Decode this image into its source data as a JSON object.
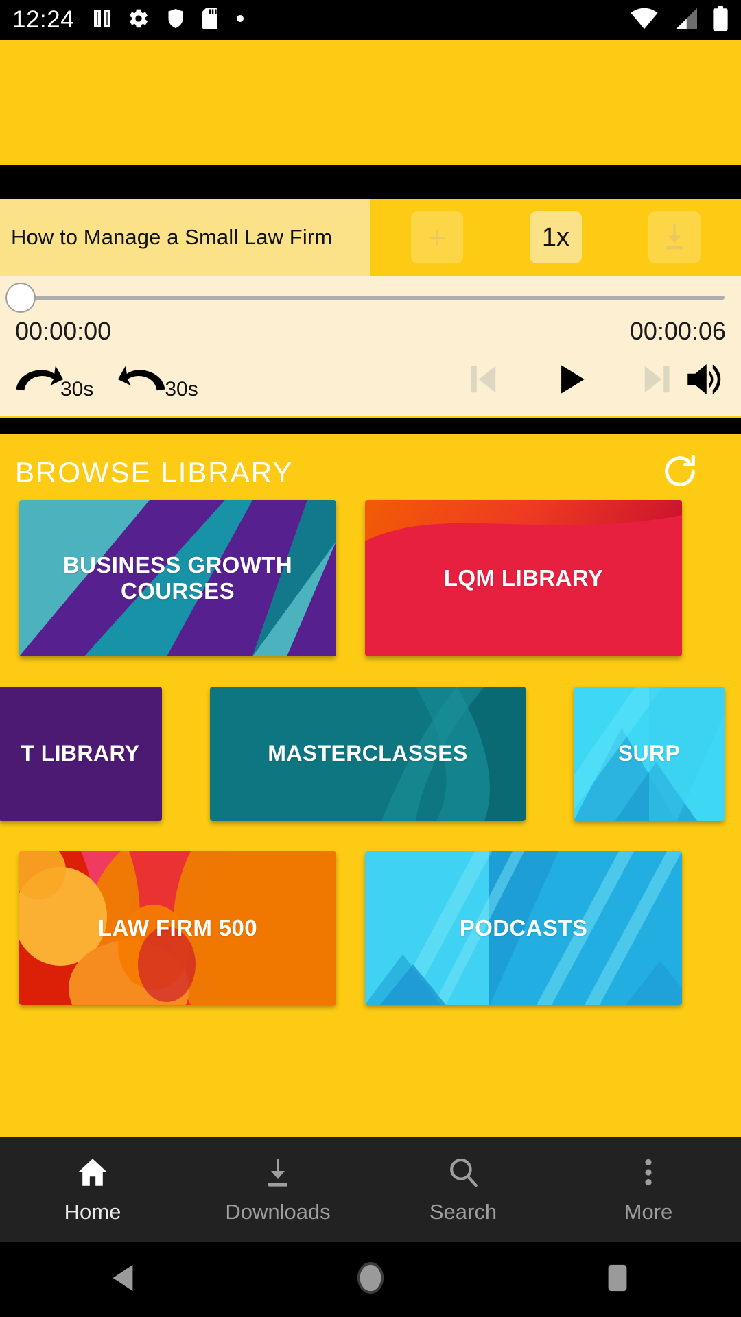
{
  "status_bar": {
    "time": "12:24",
    "left_icons": [
      "pause-bars-icon",
      "gear-icon",
      "shield-icon",
      "sd-card-icon",
      "dot-icon"
    ],
    "right_icons": [
      "wifi-icon",
      "cell-signal-icon",
      "battery-icon"
    ]
  },
  "player": {
    "track_title": "How to Manage a Small Law Firm",
    "add_label": "+",
    "speed_label": "1x",
    "download_icon": "download-icon",
    "elapsed_time": "00:00:00",
    "total_time": "00:00:06",
    "progress_percent": 0,
    "controls": {
      "forward_30_label": "30s",
      "rewind_30_label": "30s",
      "previous_icon": "skip-previous-icon",
      "play_icon": "play-icon",
      "next_icon": "skip-next-icon",
      "volume_icon": "volume-up-icon"
    }
  },
  "library": {
    "section_title": "BROWSE LIBRARY",
    "refresh_icon": "refresh-icon",
    "row1": [
      {
        "label": "BUSINESS GROWTH COURSES",
        "art": "diagonal-teal-purple"
      },
      {
        "label": "LQM LIBRARY",
        "art": "red-orange-wave"
      }
    ],
    "row2": [
      {
        "label": "T LIBRARY",
        "art": "solid-purple",
        "clipped": "left"
      },
      {
        "label": "MASTERCLASSES",
        "art": "teal-swoosh"
      },
      {
        "label": "SURP",
        "art": "cyan-mountain",
        "clipped": "right"
      }
    ],
    "row3": [
      {
        "label": "LAW FIRM 500",
        "art": "red-orange-circles"
      },
      {
        "label": "PODCASTS",
        "art": "blue-diagonal"
      }
    ]
  },
  "bottom_nav": {
    "items": [
      {
        "label": "Home",
        "icon": "home-icon",
        "active": true
      },
      {
        "label": "Downloads",
        "icon": "download-icon",
        "active": false
      },
      {
        "label": "Search",
        "icon": "search-icon",
        "active": false
      },
      {
        "label": "More",
        "icon": "overflow-dots-icon",
        "active": false
      }
    ]
  },
  "android_nav": {
    "back_icon": "back-triangle-icon",
    "home_icon": "home-circle-icon",
    "recents_icon": "recents-square-icon"
  },
  "colors": {
    "brand_yellow": "#FDCB14",
    "panel_yellow": "#FBE289",
    "seek_bg": "#FCEFD2",
    "nav_bg": "#222222"
  }
}
